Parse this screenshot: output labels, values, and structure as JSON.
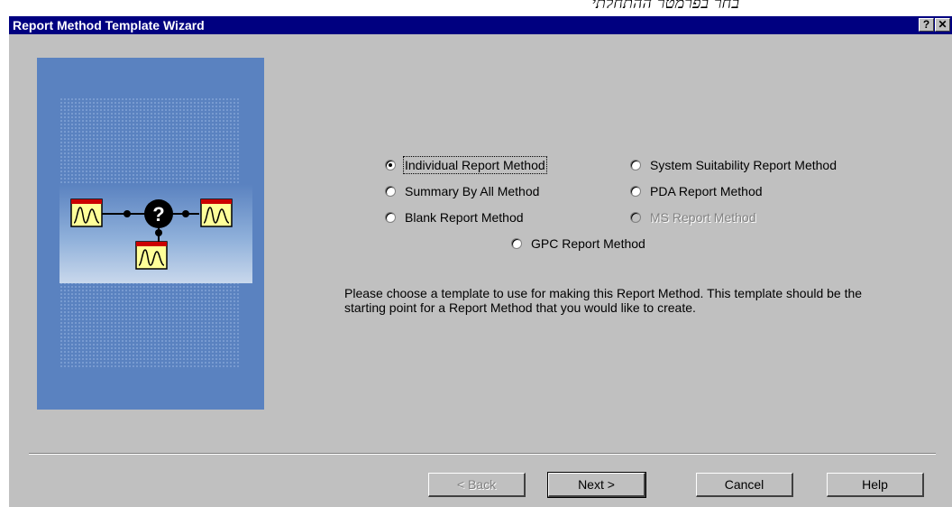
{
  "header_note": "בחר בפרמטר ההתחלתי",
  "window": {
    "title": "Report Method Template Wizard",
    "help_button": "?",
    "close_button": "✕"
  },
  "options": {
    "individual": {
      "label": "Individual Report Method",
      "selected": true
    },
    "summary": {
      "label": "Summary By All Method",
      "selected": false
    },
    "blank": {
      "label": "Blank Report Method",
      "selected": false
    },
    "system_suitability": {
      "label": "System Suitability Report Method",
      "selected": false
    },
    "pda": {
      "label": "PDA Report Method",
      "selected": false
    },
    "ms": {
      "label": "MS Report Method",
      "selected": false,
      "enabled": false
    },
    "gpc": {
      "label": "GPC Report Method",
      "selected": false
    }
  },
  "description": "Please choose a template to use for making this Report Method.  This template should be the starting point for a Report Method that you would like to create.",
  "buttons": {
    "back": "< Back",
    "next": "Next >",
    "cancel": "Cancel",
    "help": "Help"
  },
  "colors": {
    "titlebar": "#000080",
    "dialog": "#c0c0c0",
    "panel": "#5a82c0",
    "chrom_box": "#ffff99",
    "chrom_border": "#cc0000"
  }
}
